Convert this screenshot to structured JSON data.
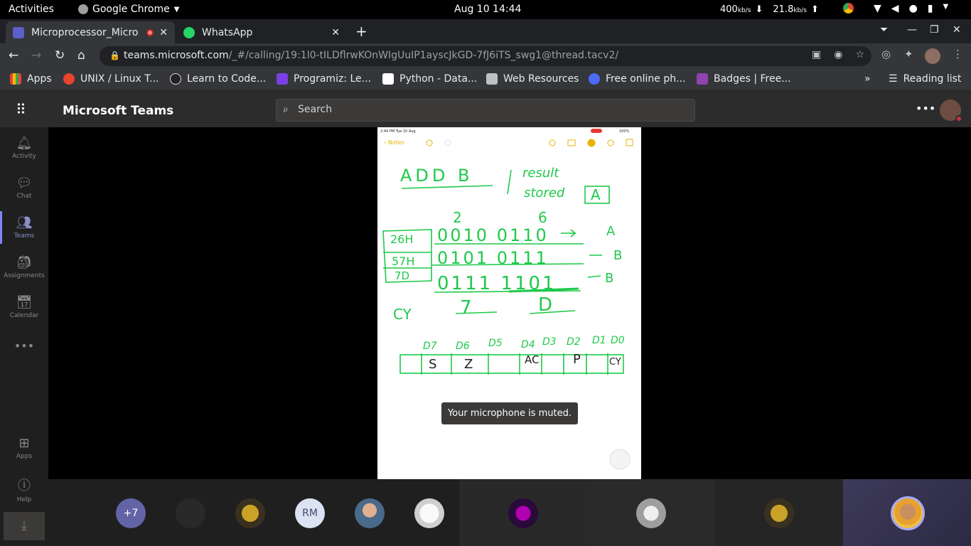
{
  "system_bar": {
    "activities": "Activities",
    "app_name": "Google Chrome",
    "clock": "Aug 10  14:44",
    "download_speed": "400",
    "download_unit": "kb/s",
    "upload_speed": "21.8",
    "upload_unit": "kb/s"
  },
  "browser": {
    "tabs": [
      {
        "title": "Microprocessor_Micro",
        "active": true
      },
      {
        "title": "WhatsApp",
        "active": false
      }
    ],
    "url_host": "teams.microsoft.com",
    "url_path": "/_#/calling/19:1l0-tILDflrwKOnWIgUuIP1ayscJkGD-7fJ6iTS_swg1@thread.tacv2/",
    "bookmarks": [
      {
        "label": "Apps",
        "color": "#e8eaed"
      },
      {
        "label": "UNIX / Linux T...",
        "color": "#e8452c"
      },
      {
        "label": "Learn to Code...",
        "color": "#222222"
      },
      {
        "label": "Programiz: Le...",
        "color": "#7b3fe4"
      },
      {
        "label": "Python - Data...",
        "color": "#ffffff"
      },
      {
        "label": "Web Resources",
        "color": "#bdc1c6"
      },
      {
        "label": "Free online ph...",
        "color": "#4a6cf7"
      },
      {
        "label": "Badges | Free...",
        "color": "#8e44ad"
      }
    ],
    "reading_list": "Reading list"
  },
  "teams": {
    "title": "Microsoft Teams",
    "search_placeholder": "Search",
    "rail": [
      {
        "label": "Activity",
        "icon": "bell-icon"
      },
      {
        "label": "Chat",
        "icon": "chat-icon"
      },
      {
        "label": "Teams",
        "icon": "teams-icon"
      },
      {
        "label": "Assignments",
        "icon": "assignments-icon"
      },
      {
        "label": "Calendar",
        "icon": "calendar-icon"
      }
    ],
    "rail_bottom": [
      {
        "label": "Apps",
        "icon": "apps-icon"
      },
      {
        "label": "Help",
        "icon": "help-icon"
      }
    ],
    "toast": "Your microphone is muted.",
    "participants": [
      {
        "label": "+7",
        "kind": "overflow",
        "color": "#6264a7"
      },
      {
        "label": "",
        "kind": "blank",
        "color": "#292929"
      },
      {
        "label": "",
        "kind": "photo",
        "color": "#5a4a1f"
      },
      {
        "label": "RM",
        "kind": "initials",
        "color": "#dbe2f3"
      },
      {
        "label": "",
        "kind": "photo",
        "color": "#4a6a8a"
      },
      {
        "label": "",
        "kind": "photo",
        "color": "#cfcfcf"
      },
      {
        "label": "",
        "kind": "photo",
        "color": "#2a0a3a"
      },
      {
        "label": "",
        "kind": "photo",
        "color": "#bdbdbd"
      },
      {
        "label": "",
        "kind": "photo",
        "color": "#5a4a1f"
      },
      {
        "label": "",
        "kind": "photo",
        "color": "#c89060"
      }
    ]
  },
  "shared_screen": {
    "status_time": "2:44 PM  Tue 10 Aug",
    "notes_back": "Notes",
    "battery": "100%",
    "ink_color": "#1fc94a",
    "ink_text": {
      "heading": "ADD B",
      "note_a": "result",
      "note_b": "stored",
      "reg_a": "A",
      "hex_digits": [
        "2",
        "6"
      ],
      "row1_label": "26H",
      "row1_bits": "0010   0110",
      "row1_reg": "A",
      "row2_label": "57H",
      "row2_bits": "0101   0111",
      "row2_reg": "B",
      "row3_label": "7D",
      "row3_bits": "0111   1101",
      "row3_reg": "B",
      "cy": "CY",
      "res_hi": "7",
      "res_lo": "D",
      "flags_header": [
        "D7",
        "D6",
        "D5",
        "D4",
        "D3",
        "D2",
        "D1",
        "D0"
      ],
      "flags": [
        "S",
        "Z",
        "",
        "AC",
        "",
        "P",
        "",
        "CY"
      ]
    }
  }
}
